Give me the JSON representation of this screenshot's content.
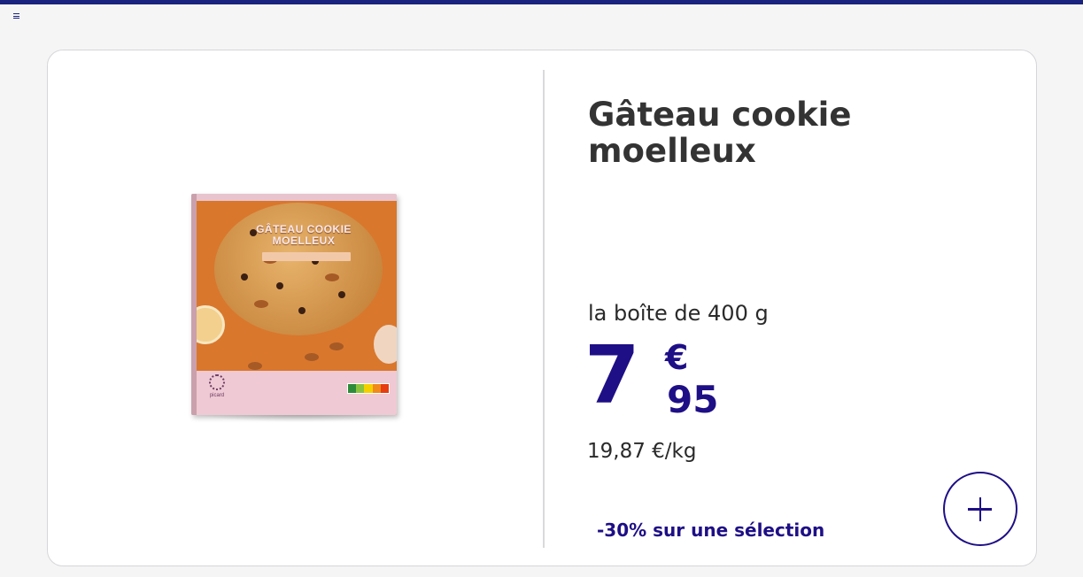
{
  "colors": {
    "accent": "#1e0f86",
    "top_bar": "#1a237e",
    "title_text": "#333333",
    "card_border": "#d6d6da",
    "background": "#f5f5f6"
  },
  "header": {
    "menu_icon": "hamburger-menu-icon"
  },
  "product": {
    "title": "Gâteau cookie moelleux",
    "image": {
      "box_title": "GÂTEAU COOKIE MOELLEUX",
      "brand": "picard"
    },
    "unit": "la boîte de 400 g",
    "price": {
      "integer": "7",
      "currency": "€",
      "cents": "95"
    },
    "price_per_kg": "19,87 €/kg",
    "promo": "-30% sur une sélection",
    "add_button_icon": "plus-icon"
  }
}
